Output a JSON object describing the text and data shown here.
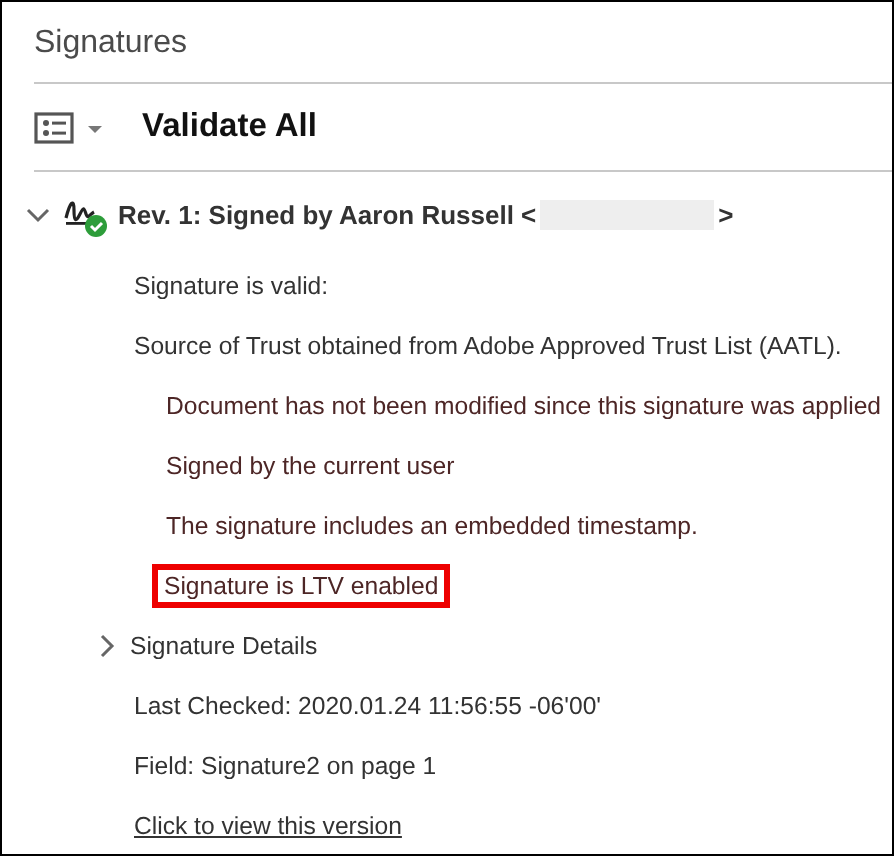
{
  "panel": {
    "title": "Signatures"
  },
  "toolbar": {
    "label": "Validate All"
  },
  "revision": {
    "expanded": true,
    "valid": true,
    "label": "Rev. 1: Signed by Aaron Russell <",
    "label_end": ">",
    "summary": [
      "Signature is valid:",
      "Source of Trust obtained from Adobe Approved Trust List (AATL)."
    ],
    "checks": [
      {
        "text": "Document has not been modified since this signature was applied",
        "highlighted": false
      },
      {
        "text": "Signed by the current user",
        "highlighted": false
      },
      {
        "text": "The signature includes an embedded timestamp.",
        "highlighted": false
      },
      {
        "text": "Signature is LTV enabled",
        "highlighted": true
      }
    ],
    "details": {
      "label": "Signature Details",
      "expanded": false
    },
    "last_checked": "Last Checked: 2020.01.24 11:56:55 -06'00'",
    "field": "Field: Signature2 on page 1",
    "link": "Click to view this version"
  }
}
